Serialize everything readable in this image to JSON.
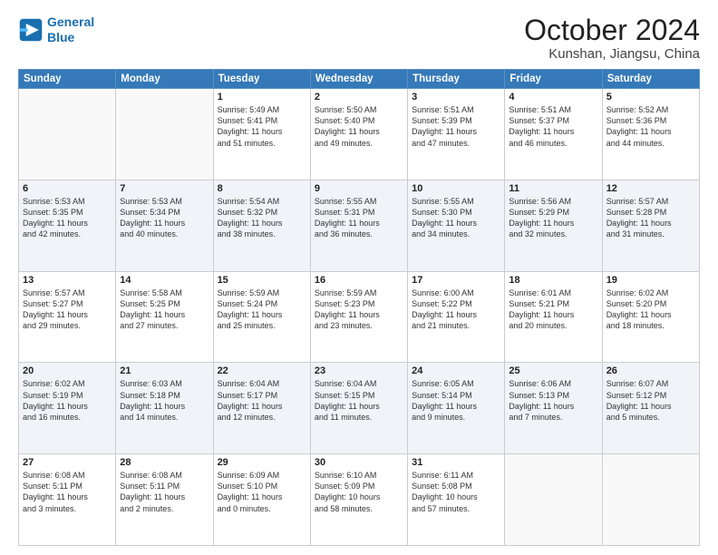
{
  "header": {
    "logo_line1": "General",
    "logo_line2": "Blue",
    "title": "October 2024",
    "subtitle": "Kunshan, Jiangsu, China"
  },
  "weekdays": [
    "Sunday",
    "Monday",
    "Tuesday",
    "Wednesday",
    "Thursday",
    "Friday",
    "Saturday"
  ],
  "weeks": [
    [
      {
        "day": "",
        "detail": ""
      },
      {
        "day": "",
        "detail": ""
      },
      {
        "day": "1",
        "detail": "Sunrise: 5:49 AM\nSunset: 5:41 PM\nDaylight: 11 hours\nand 51 minutes."
      },
      {
        "day": "2",
        "detail": "Sunrise: 5:50 AM\nSunset: 5:40 PM\nDaylight: 11 hours\nand 49 minutes."
      },
      {
        "day": "3",
        "detail": "Sunrise: 5:51 AM\nSunset: 5:39 PM\nDaylight: 11 hours\nand 47 minutes."
      },
      {
        "day": "4",
        "detail": "Sunrise: 5:51 AM\nSunset: 5:37 PM\nDaylight: 11 hours\nand 46 minutes."
      },
      {
        "day": "5",
        "detail": "Sunrise: 5:52 AM\nSunset: 5:36 PM\nDaylight: 11 hours\nand 44 minutes."
      }
    ],
    [
      {
        "day": "6",
        "detail": "Sunrise: 5:53 AM\nSunset: 5:35 PM\nDaylight: 11 hours\nand 42 minutes."
      },
      {
        "day": "7",
        "detail": "Sunrise: 5:53 AM\nSunset: 5:34 PM\nDaylight: 11 hours\nand 40 minutes."
      },
      {
        "day": "8",
        "detail": "Sunrise: 5:54 AM\nSunset: 5:32 PM\nDaylight: 11 hours\nand 38 minutes."
      },
      {
        "day": "9",
        "detail": "Sunrise: 5:55 AM\nSunset: 5:31 PM\nDaylight: 11 hours\nand 36 minutes."
      },
      {
        "day": "10",
        "detail": "Sunrise: 5:55 AM\nSunset: 5:30 PM\nDaylight: 11 hours\nand 34 minutes."
      },
      {
        "day": "11",
        "detail": "Sunrise: 5:56 AM\nSunset: 5:29 PM\nDaylight: 11 hours\nand 32 minutes."
      },
      {
        "day": "12",
        "detail": "Sunrise: 5:57 AM\nSunset: 5:28 PM\nDaylight: 11 hours\nand 31 minutes."
      }
    ],
    [
      {
        "day": "13",
        "detail": "Sunrise: 5:57 AM\nSunset: 5:27 PM\nDaylight: 11 hours\nand 29 minutes."
      },
      {
        "day": "14",
        "detail": "Sunrise: 5:58 AM\nSunset: 5:25 PM\nDaylight: 11 hours\nand 27 minutes."
      },
      {
        "day": "15",
        "detail": "Sunrise: 5:59 AM\nSunset: 5:24 PM\nDaylight: 11 hours\nand 25 minutes."
      },
      {
        "day": "16",
        "detail": "Sunrise: 5:59 AM\nSunset: 5:23 PM\nDaylight: 11 hours\nand 23 minutes."
      },
      {
        "day": "17",
        "detail": "Sunrise: 6:00 AM\nSunset: 5:22 PM\nDaylight: 11 hours\nand 21 minutes."
      },
      {
        "day": "18",
        "detail": "Sunrise: 6:01 AM\nSunset: 5:21 PM\nDaylight: 11 hours\nand 20 minutes."
      },
      {
        "day": "19",
        "detail": "Sunrise: 6:02 AM\nSunset: 5:20 PM\nDaylight: 11 hours\nand 18 minutes."
      }
    ],
    [
      {
        "day": "20",
        "detail": "Sunrise: 6:02 AM\nSunset: 5:19 PM\nDaylight: 11 hours\nand 16 minutes."
      },
      {
        "day": "21",
        "detail": "Sunrise: 6:03 AM\nSunset: 5:18 PM\nDaylight: 11 hours\nand 14 minutes."
      },
      {
        "day": "22",
        "detail": "Sunrise: 6:04 AM\nSunset: 5:17 PM\nDaylight: 11 hours\nand 12 minutes."
      },
      {
        "day": "23",
        "detail": "Sunrise: 6:04 AM\nSunset: 5:15 PM\nDaylight: 11 hours\nand 11 minutes."
      },
      {
        "day": "24",
        "detail": "Sunrise: 6:05 AM\nSunset: 5:14 PM\nDaylight: 11 hours\nand 9 minutes."
      },
      {
        "day": "25",
        "detail": "Sunrise: 6:06 AM\nSunset: 5:13 PM\nDaylight: 11 hours\nand 7 minutes."
      },
      {
        "day": "26",
        "detail": "Sunrise: 6:07 AM\nSunset: 5:12 PM\nDaylight: 11 hours\nand 5 minutes."
      }
    ],
    [
      {
        "day": "27",
        "detail": "Sunrise: 6:08 AM\nSunset: 5:11 PM\nDaylight: 11 hours\nand 3 minutes."
      },
      {
        "day": "28",
        "detail": "Sunrise: 6:08 AM\nSunset: 5:11 PM\nDaylight: 11 hours\nand 2 minutes."
      },
      {
        "day": "29",
        "detail": "Sunrise: 6:09 AM\nSunset: 5:10 PM\nDaylight: 11 hours\nand 0 minutes."
      },
      {
        "day": "30",
        "detail": "Sunrise: 6:10 AM\nSunset: 5:09 PM\nDaylight: 10 hours\nand 58 minutes."
      },
      {
        "day": "31",
        "detail": "Sunrise: 6:11 AM\nSunset: 5:08 PM\nDaylight: 10 hours\nand 57 minutes."
      },
      {
        "day": "",
        "detail": ""
      },
      {
        "day": "",
        "detail": ""
      }
    ]
  ]
}
